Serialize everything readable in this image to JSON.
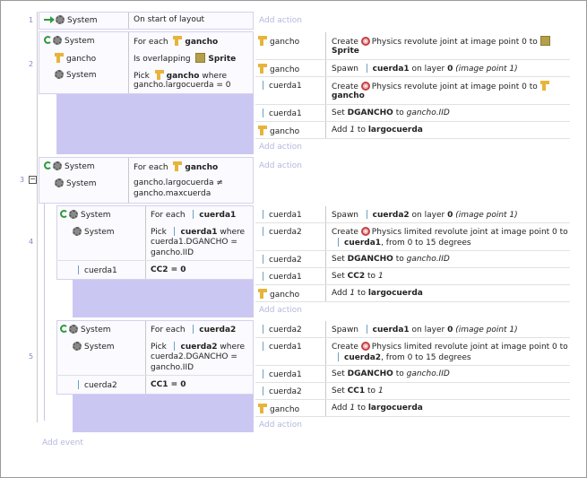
{
  "events": {
    "e1": {
      "number": "1",
      "cond_object": "System",
      "cond_text": "On start of layout",
      "add_action": "Add action"
    },
    "e2": {
      "number": "2",
      "c1_object": "System",
      "c1_text": "For each",
      "c1_param": "gancho",
      "c2_object": "gancho",
      "c2_text": "Is overlapping",
      "c2_param": "Sprite",
      "c3_object": "System",
      "c3_text": "Pick",
      "c3_param": "gancho",
      "c3_where": "where",
      "c3_expr": "gancho.largocuerda = 0",
      "actions": [
        {
          "object": "gancho",
          "line1": "Create",
          "line1b": "Physics revolute joint at image point 0 to",
          "line2": "Sprite"
        },
        {
          "object": "gancho",
          "verb": "Spawn",
          "param": "cuerda1",
          "rest": "on layer",
          "layer": "0",
          "extra": "(image point 1)"
        },
        {
          "object": "cuerda1",
          "line1": "Create",
          "line1b": "Physics revolute joint at image point 0 to",
          "line2": "gancho"
        },
        {
          "object": "cuerda1",
          "verb": "Set",
          "param": "DGANCHO",
          "rest": "to",
          "value": "gancho.IID"
        },
        {
          "object": "gancho",
          "verb": "Add",
          "num": "1",
          "rest": "to",
          "param": "largocuerda"
        }
      ],
      "add_action": "Add action"
    },
    "e3": {
      "number": "3",
      "c1_object": "System",
      "c1_text": "For each",
      "c1_param": "gancho",
      "c2_object": "System",
      "c2_line1": "gancho.largocuerda ≠",
      "c2_line2": "gancho.maxcuerda",
      "add_action": "Add action"
    },
    "e4": {
      "number": "4",
      "c1_object": "System",
      "c1_text": "For each",
      "c1_param": "cuerda1",
      "c2_object": "System",
      "c2_text": "Pick",
      "c2_param": "cuerda1",
      "c2_where": "where",
      "c2_line2": "cuerda1.DGANCHO =",
      "c2_line3": "gancho.IID",
      "c3_object": "cuerda1",
      "c3_text": "CC2 = 0",
      "actions": [
        {
          "object": "cuerda1",
          "verb": "Spawn",
          "param": "cuerda2",
          "rest": "on layer",
          "layer": "0",
          "extra": "(image point 1)"
        },
        {
          "object": "cuerda2",
          "line1": "Create",
          "line1b": "Physics limited revolute joint at image point 0 to",
          "param": "cuerda1",
          "line2": ", from 0 to 15 degrees"
        },
        {
          "object": "cuerda2",
          "verb": "Set",
          "param": "DGANCHO",
          "rest": "to",
          "value": "gancho.IID"
        },
        {
          "object": "cuerda1",
          "verb": "Set",
          "param": "CC2",
          "rest": "to",
          "value": "1"
        },
        {
          "object": "gancho",
          "verb": "Add",
          "num": "1",
          "rest": "to",
          "param": "largocuerda"
        }
      ],
      "add_action": "Add action"
    },
    "e5": {
      "number": "5",
      "c1_object": "System",
      "c1_text": "For each",
      "c1_param": "cuerda2",
      "c2_object": "System",
      "c2_text": "Pick",
      "c2_param": "cuerda2",
      "c2_where": "where",
      "c2_line2": "cuerda2.DGANCHO =",
      "c2_line3": "gancho.IID",
      "c3_object": "cuerda2",
      "c3_text": "CC1 = 0",
      "actions": [
        {
          "object": "cuerda2",
          "verb": "Spawn",
          "param": "cuerda1",
          "rest": "on layer",
          "layer": "0",
          "extra": "(image point 1)"
        },
        {
          "object": "cuerda1",
          "line1": "Create",
          "line1b": "Physics limited revolute joint at image point 0 to",
          "param": "cuerda2",
          "line2": ", from 0 to 15 degrees"
        },
        {
          "object": "cuerda1",
          "verb": "Set",
          "param": "DGANCHO",
          "rest": "to",
          "value": "gancho.IID"
        },
        {
          "object": "cuerda2",
          "verb": "Set",
          "param": "CC1",
          "rest": "to",
          "value": "1"
        },
        {
          "object": "gancho",
          "verb": "Add",
          "num": "1",
          "rest": "to",
          "param": "largocuerda"
        }
      ],
      "add_action": "Add action"
    }
  },
  "footer": {
    "add_event": "Add event"
  },
  "colors": {
    "accent": "#cbc7f3",
    "add_text": "#b4b7df",
    "line_number": "#7f88c2"
  },
  "icons": [
    "system-gear-icon",
    "start-arrow-icon",
    "loop-icon",
    "gancho-hook-icon",
    "sprite-icon",
    "physics-icon",
    "cuerda-bar-icon",
    "collapse-icon"
  ]
}
